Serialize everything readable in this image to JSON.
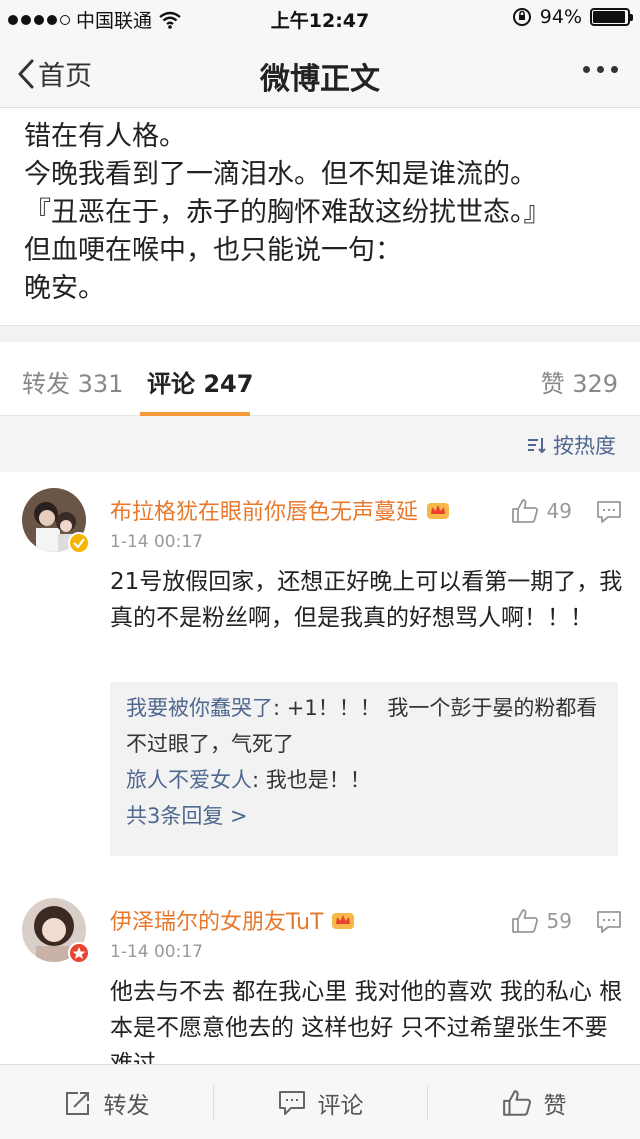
{
  "status_bar": {
    "carrier": "中国联通",
    "time": "上午12:47",
    "battery_percent": "94%",
    "battery_level": 0.94
  },
  "nav": {
    "back_label": "首页",
    "title": "微博正文"
  },
  "post": {
    "lines": [
      "错在有人格。",
      "今晚我看到了一滴泪水。但不知是谁流的。",
      "『丑恶在于，赤子的胸怀难敌这纷扰世态。』",
      "但血哽在喉中，也只能说一句：",
      "晚安。"
    ]
  },
  "tabs": {
    "repost": "转发 331",
    "comments": "评论 247",
    "likes": "赞 329"
  },
  "sort": {
    "label": "按热度"
  },
  "comments": [
    {
      "user": "布拉格犹在眼前你唇色无声蔓延",
      "time": "1-14 00:17",
      "likes": "49",
      "text": "21号放假回家，还想正好晚上可以看第一期了，我真的不是粉丝啊，但是我真的好想骂人啊！！！",
      "replies": [
        {
          "user": "我要被你蠢哭了",
          "text": ": +1！！！ 我一个彭于晏的粉都看不过眼了，气死了"
        },
        {
          "user": "旅人不爱女人",
          "text": ": 我也是！！"
        }
      ],
      "more_replies": "共3条回复 >"
    },
    {
      "user": "伊泽瑞尔的女朋友TuT",
      "time": "1-14 00:17",
      "likes": "59",
      "text": "他去与不去 都在我心里 我对他的喜欢 我的私心 根本是不愿意他去的 这样也好 只不过希望张生不要难过"
    }
  ],
  "bottom_bar": {
    "repost": "转发",
    "comment": "评论",
    "like": "赞"
  },
  "colors": {
    "accent": "#f59a3b",
    "username": "#e8792c",
    "link": "#50688f"
  }
}
